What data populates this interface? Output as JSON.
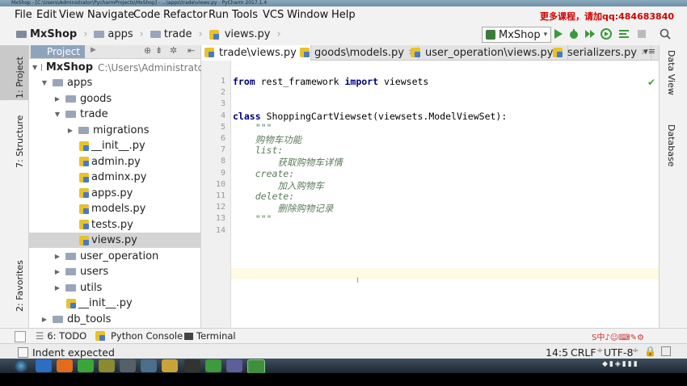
{
  "window": {
    "title": "MxShop - [C:\\Users\\Administrator\\PycharmProjects\\MxShop] - ...\\apps\\trade\\views.py - PyCharm 2017.1.4"
  },
  "menu": {
    "items": [
      "File",
      "Edit",
      "View",
      "Navigate",
      "Code",
      "Refactor",
      "Run",
      "Tools",
      "VCS",
      "Window",
      "Help"
    ],
    "promo": "更多课程，请加qq:484683840"
  },
  "nav": {
    "crumbs": [
      "MxShop",
      "apps",
      "trade",
      "views.py"
    ],
    "run_config": "MxShop"
  },
  "left_strip": {
    "tabs": [
      "1: Project",
      "7: Structure",
      "2: Favorites"
    ]
  },
  "right_strip": {
    "tabs": [
      "Data View",
      "Database"
    ]
  },
  "project": {
    "header": "Project",
    "root": {
      "name": "MxShop",
      "path": "C:\\Users\\Administrato"
    },
    "tree": [
      {
        "label": "apps",
        "type": "folder",
        "depth": 1,
        "arrow": "▼"
      },
      {
        "label": "goods",
        "type": "folder",
        "depth": 2,
        "arrow": "▶"
      },
      {
        "label": "trade",
        "type": "folder",
        "depth": 2,
        "arrow": "▼"
      },
      {
        "label": "migrations",
        "type": "folder",
        "depth": 3,
        "arrow": "▶"
      },
      {
        "label": "__init__.py",
        "type": "py",
        "depth": 3
      },
      {
        "label": "admin.py",
        "type": "py",
        "depth": 3
      },
      {
        "label": "adminx.py",
        "type": "py",
        "depth": 3
      },
      {
        "label": "apps.py",
        "type": "py",
        "depth": 3
      },
      {
        "label": "models.py",
        "type": "py",
        "depth": 3
      },
      {
        "label": "tests.py",
        "type": "py",
        "depth": 3
      },
      {
        "label": "views.py",
        "type": "py",
        "depth": 3,
        "selected": true
      },
      {
        "label": "user_operation",
        "type": "folder",
        "depth": 2,
        "arrow": "▶"
      },
      {
        "label": "users",
        "type": "folder",
        "depth": 2,
        "arrow": "▶"
      },
      {
        "label": "utils",
        "type": "folder",
        "depth": 2,
        "arrow": "▶"
      },
      {
        "label": "__init__.py",
        "type": "py",
        "depth": 2
      },
      {
        "label": "db_tools",
        "type": "folder",
        "depth": 1,
        "arrow": "▶"
      }
    ]
  },
  "editor": {
    "tabs": [
      {
        "label": "trade\\views.py",
        "active": true
      },
      {
        "label": "goods\\models.py",
        "active": false
      },
      {
        "label": "user_operation\\views.py",
        "active": false
      },
      {
        "label": "serializers.py",
        "active": false
      }
    ],
    "tab_overflow": "▾≡",
    "lines": [
      {
        "n": "1",
        "text": "from rest_framework import viewsets"
      },
      {
        "n": "2",
        "text": ""
      },
      {
        "n": "3",
        "text": ""
      },
      {
        "n": "4",
        "text": "class ShoppingCartViewset(viewsets.ModelViewSet):"
      },
      {
        "n": "5",
        "text": "    \"\"\""
      },
      {
        "n": "6",
        "text": "    购物车功能"
      },
      {
        "n": "7",
        "text": "    list:"
      },
      {
        "n": "8",
        "text": "        获取购物车详情"
      },
      {
        "n": "9",
        "text": "    create:"
      },
      {
        "n": "10",
        "text": "        加入购物车"
      },
      {
        "n": "11",
        "text": "    delete:"
      },
      {
        "n": "12",
        "text": "        删除购物记录"
      },
      {
        "n": "13",
        "text": "    \"\"\""
      },
      {
        "n": "14",
        "text": ""
      }
    ]
  },
  "bottom_tabs": [
    "6: TODO",
    "Python Console",
    "Terminal"
  ],
  "status": {
    "message": "Indent expected",
    "position": "14:5",
    "line_sep": "CRLF",
    "encoding": "UTF-8"
  }
}
